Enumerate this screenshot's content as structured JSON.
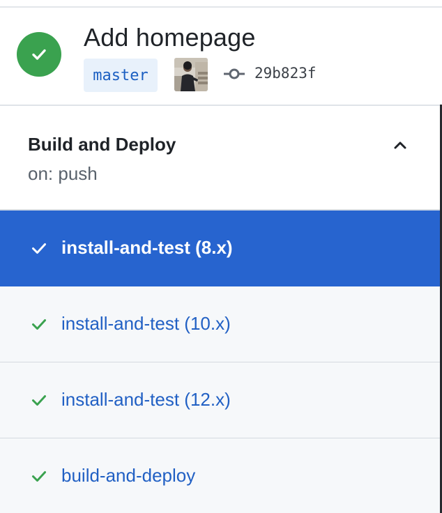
{
  "run": {
    "status": "success",
    "title": "Add homepage",
    "branch": "master",
    "commit_sha": "29b823f"
  },
  "workflow": {
    "name": "Build and Deploy",
    "trigger": "on: push",
    "expanded": true
  },
  "jobs": [
    {
      "label": "install-and-test (8.x)",
      "status": "success",
      "selected": true
    },
    {
      "label": "install-and-test (10.x)",
      "status": "success",
      "selected": false
    },
    {
      "label": "install-and-test (12.x)",
      "status": "success",
      "selected": false
    },
    {
      "label": "build-and-deploy",
      "status": "success",
      "selected": false
    }
  ],
  "icons": {
    "status": "check-circle-icon",
    "commit": "git-commit-icon",
    "collapse": "chevron-up-icon",
    "job_status": "check-icon"
  },
  "colors": {
    "success": "#3aa24f",
    "selected_job": "#2764cf",
    "link": "#2160c4",
    "branch_bg": "#e8f1fb"
  }
}
